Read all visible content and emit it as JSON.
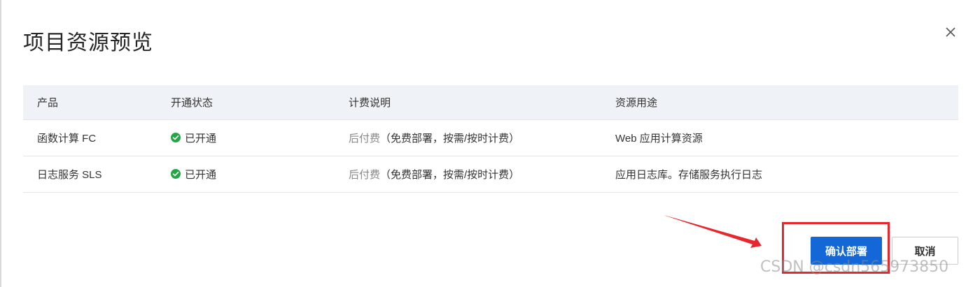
{
  "dialog": {
    "title": "项目资源预览",
    "close_icon": "close-icon"
  },
  "table": {
    "headers": [
      "产品",
      "开通状态",
      "计费说明",
      "资源用途"
    ],
    "rows": [
      {
        "product": "函数计算 FC",
        "status": "已开通",
        "status_icon": "check-circle-icon",
        "billing_type": "后付费",
        "billing_detail": "（免费部署，按需/按时计费）",
        "usage": "Web 应用计算资源"
      },
      {
        "product": "日志服务 SLS",
        "status": "已开通",
        "status_icon": "check-circle-icon",
        "billing_type": "后付费",
        "billing_detail": "（免费部署，按需/按时计费）",
        "usage": "应用日志库。存储服务执行日志"
      }
    ]
  },
  "footer": {
    "confirm_label": "确认部署",
    "cancel_label": "取消"
  },
  "annotation": {
    "arrow_color": "#e8262d",
    "box_color": "#e8262d"
  },
  "watermark": "CSDN @csdn565973850",
  "colors": {
    "primary": "#1367d6",
    "success": "#23a644",
    "header_bg": "#eff2f6"
  }
}
